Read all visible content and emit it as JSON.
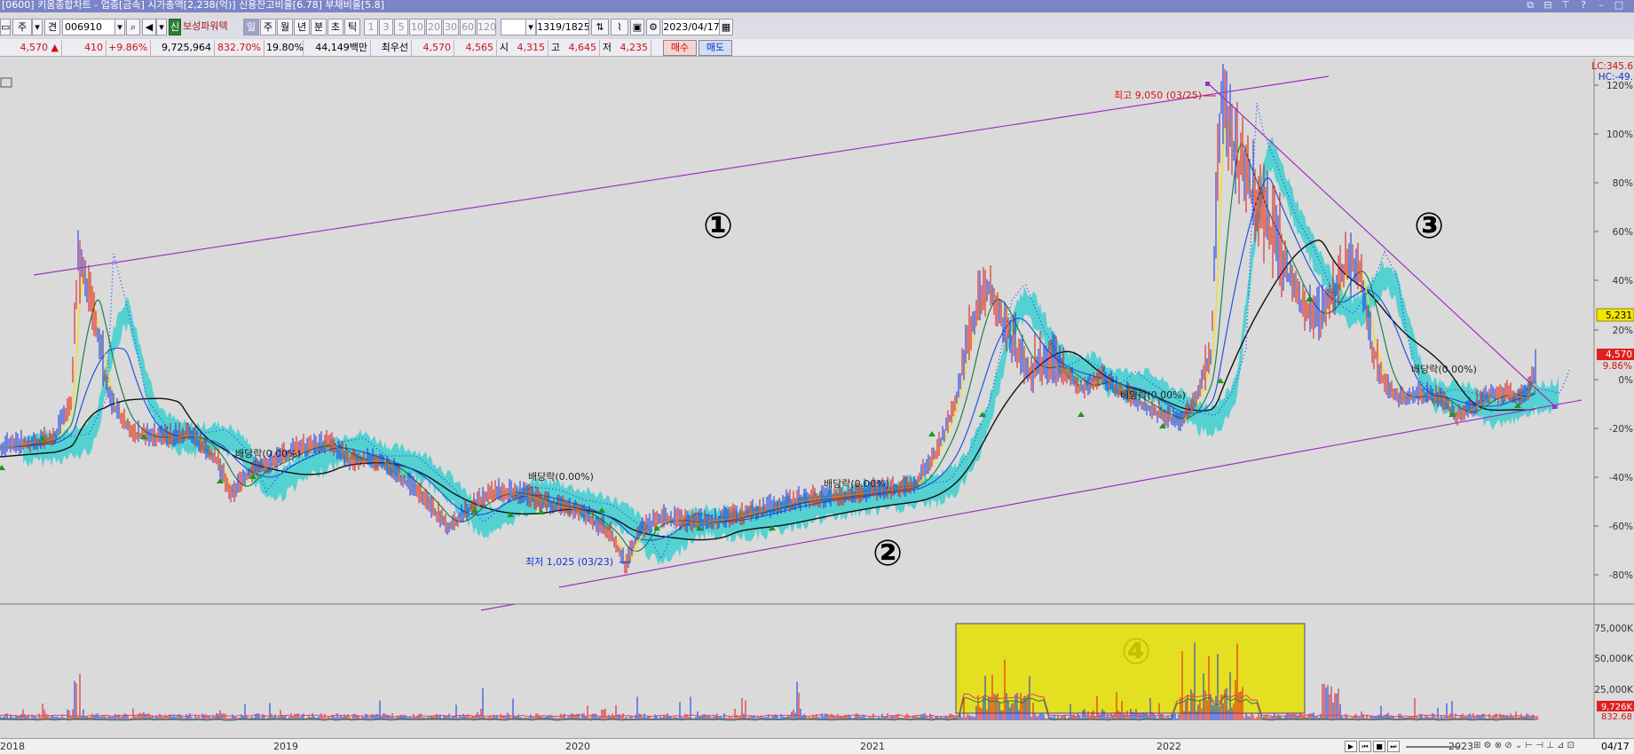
{
  "window": {
    "title": "[0600] 키움종합차트 - 업종[금속] 시가총액[2,238(억)] 신용잔고비율[6.78] 부채비율[5.8]"
  },
  "toolbar": {
    "period_btn": "주",
    "type_btn": "견",
    "stock_code": "006910",
    "indicator_badge": "신",
    "stock_name": "보성파워텍",
    "periods": [
      "일",
      "주",
      "월",
      "년",
      "분",
      "초",
      "틱"
    ],
    "minutes": [
      "1",
      "3",
      "5",
      "10",
      "20",
      "30",
      "60",
      "120"
    ],
    "count": "1319/1825",
    "date": "2023/04/17"
  },
  "quote": {
    "price": "4,570",
    "arrow": "▲",
    "change": "410",
    "change_pct": "+9.86%",
    "volume": "9,725,964",
    "volume_ratio": "832.70%",
    "turnover": "19.80%",
    "amount": "44,149백만",
    "best_label": "최우선",
    "ask": "4,570",
    "bid": "4,565",
    "open_label": "시",
    "open": "4,315",
    "high_label": "고",
    "high": "4,645",
    "low_label": "저",
    "low": "4,235",
    "buy_label": "매수",
    "sell_label": "매도"
  },
  "chart": {
    "lc": "LC:345.6",
    "hc": "HC:-49.",
    "price_badge": "5,231",
    "current_badge": "4,570",
    "pct_badge": "9.86%",
    "y_labels": [
      "120%",
      "100%",
      "80%",
      "60%",
      "40%",
      "20%",
      "0%",
      "-20%",
      "-40%",
      "-60%",
      "-80%"
    ],
    "vol_labels": [
      "75,000K",
      "50,000K",
      "25,000K"
    ],
    "vol_badge": "9,726K",
    "vol_ratio_badge": "832.68",
    "annotation_high": "최고 9,050 (03/25)",
    "annotation_low": "최저 1,025 (03/23)",
    "dividend_labels": [
      "배당락(0.00%)",
      "배당락(0.00%)",
      "배당락(0.00%)",
      "배당락(0.00%)",
      "배당락(0.00%)"
    ],
    "circled_labels": [
      "①",
      "②",
      "③",
      "④"
    ],
    "x_labels": [
      "2018",
      "2019",
      "2020",
      "2021",
      "2022",
      "2023",
      "04/17"
    ]
  }
}
